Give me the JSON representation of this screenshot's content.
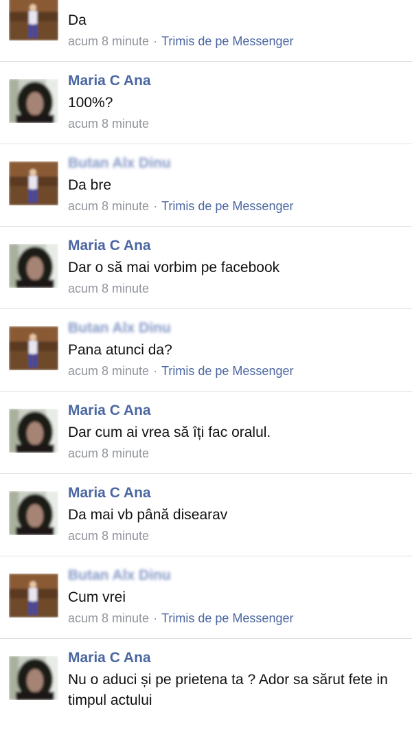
{
  "comments": [
    {
      "author": "",
      "author_blurred": true,
      "avatar": "avatar-dinu",
      "text": "Da",
      "time": "acum 8 minute",
      "source": "Trimis de pe Messenger"
    },
    {
      "author": "Maria C Ana",
      "author_blurred": false,
      "avatar": "avatar-maria",
      "text": "100%?",
      "time": "acum 8 minute",
      "source": ""
    },
    {
      "author": "Butan Alx Dinu",
      "author_blurred": true,
      "avatar": "avatar-dinu",
      "text": "Da bre",
      "time": "acum 8 minute",
      "source": "Trimis de pe Messenger"
    },
    {
      "author": "Maria C Ana",
      "author_blurred": false,
      "avatar": "avatar-maria",
      "text": "Dar o să mai vorbim pe facebook",
      "time": "acum 8 minute",
      "source": ""
    },
    {
      "author": "Butan Alx Dinu",
      "author_blurred": true,
      "avatar": "avatar-dinu",
      "text": "Pana atunci da?",
      "time": "acum 8 minute",
      "source": "Trimis de pe Messenger"
    },
    {
      "author": "Maria C Ana",
      "author_blurred": false,
      "avatar": "avatar-maria",
      "text": "Dar cum ai vrea să îți fac oralul.",
      "time": "acum 8 minute",
      "source": ""
    },
    {
      "author": "Maria C Ana",
      "author_blurred": false,
      "avatar": "avatar-maria",
      "text": "Da mai vb până disearav",
      "time": "acum 8 minute",
      "source": ""
    },
    {
      "author": "Butan Alx Dinu",
      "author_blurred": true,
      "avatar": "avatar-dinu",
      "text": "Cum vrei",
      "time": "acum 8 minute",
      "source": "Trimis de pe Messenger"
    },
    {
      "author": "Maria C Ana",
      "author_blurred": false,
      "avatar": "avatar-maria",
      "text": "Nu o aduci și pe prietena ta ? Ador sa sărut fete in timpul actului",
      "time": "",
      "source": ""
    }
  ],
  "colors": {
    "author_link": "#4b67a1",
    "meta_gray": "#90949c",
    "divider": "#dddfe2",
    "text": "#111111"
  }
}
